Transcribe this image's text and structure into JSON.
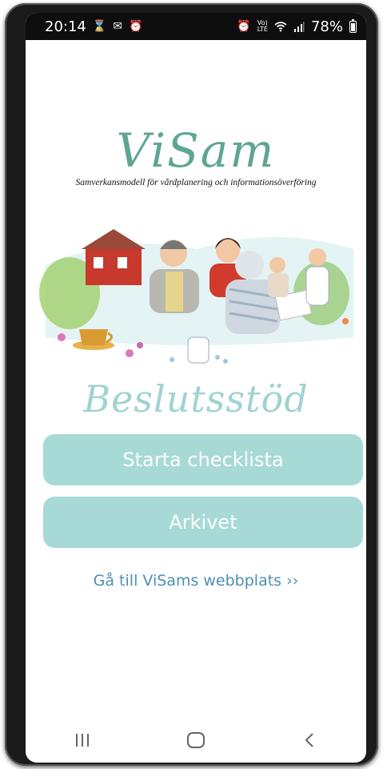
{
  "status_bar": {
    "time": "20:14",
    "battery": "78%",
    "left_icons": [
      "hourglass-icon",
      "mail-icon",
      "alarm-icon"
    ],
    "right_icons": [
      "alarm-icon",
      "volte-icon",
      "wifi-icon",
      "signal-icon",
      "battery-icon"
    ]
  },
  "logo": {
    "title": "ViSam",
    "subtitle": "Samverkansmodell för vårdplanering och informationsöverföring"
  },
  "product_title": "Beslutsstöd",
  "buttons": {
    "checklist": "Starta checklista",
    "archive": "Arkivet"
  },
  "link": {
    "website": "Gå till ViSams webbplats ››"
  },
  "nav": {
    "icons": [
      "recent-apps-icon",
      "home-icon",
      "back-icon"
    ]
  },
  "colors": {
    "logo_green": "#5fa593",
    "title_teal": "#9fd3d1",
    "button_bg": "#a7d9d7",
    "link_blue": "#4c8fb3"
  }
}
